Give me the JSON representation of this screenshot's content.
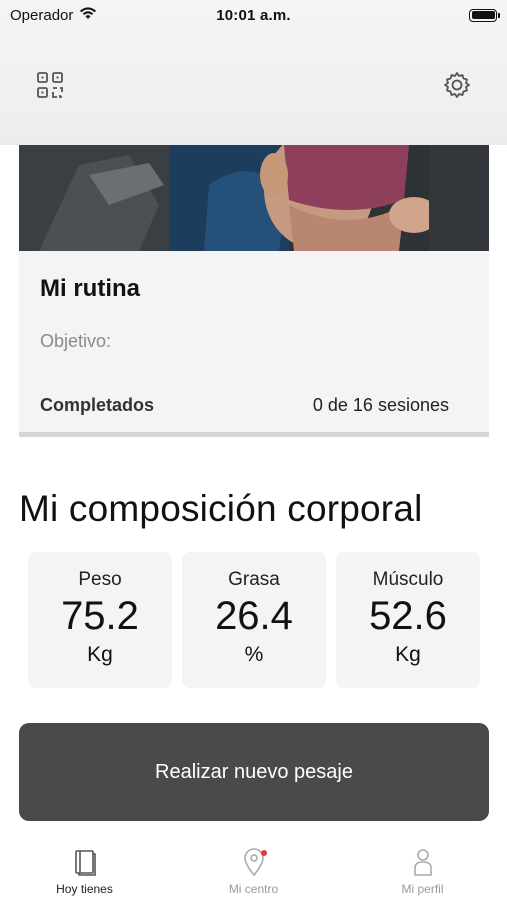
{
  "status_bar": {
    "carrier": "Operador",
    "time": "10:01 a.m."
  },
  "header": {
    "left_icon": "qr-code-icon",
    "right_icon": "gear-icon"
  },
  "routine_card": {
    "title": "Mi rutina",
    "objective_label": "Objetivo:",
    "completed_label": "Completados",
    "completed_value": "0 de 16 sesiones"
  },
  "body_composition": {
    "title": "Mi composición corporal",
    "stats": [
      {
        "label": "Peso",
        "value": "75.2",
        "unit": "Kg"
      },
      {
        "label": "Grasa",
        "value": "26.4",
        "unit": "%"
      },
      {
        "label": "Músculo",
        "value": "52.6",
        "unit": "Kg"
      }
    ]
  },
  "action_button": {
    "label": "Realizar nuevo pesaje"
  },
  "tabbar": {
    "tabs": [
      {
        "label": "Hoy tienes",
        "icon": "book-icon",
        "active": true
      },
      {
        "label": "Mi centro",
        "icon": "location-pin-icon",
        "active": false,
        "notification": true
      },
      {
        "label": "Mi perfil",
        "icon": "person-icon",
        "active": false
      }
    ]
  },
  "colors": {
    "button_bg": "#4a4a4a",
    "card_bg": "#f4f4f4",
    "notification": "#e53935"
  }
}
